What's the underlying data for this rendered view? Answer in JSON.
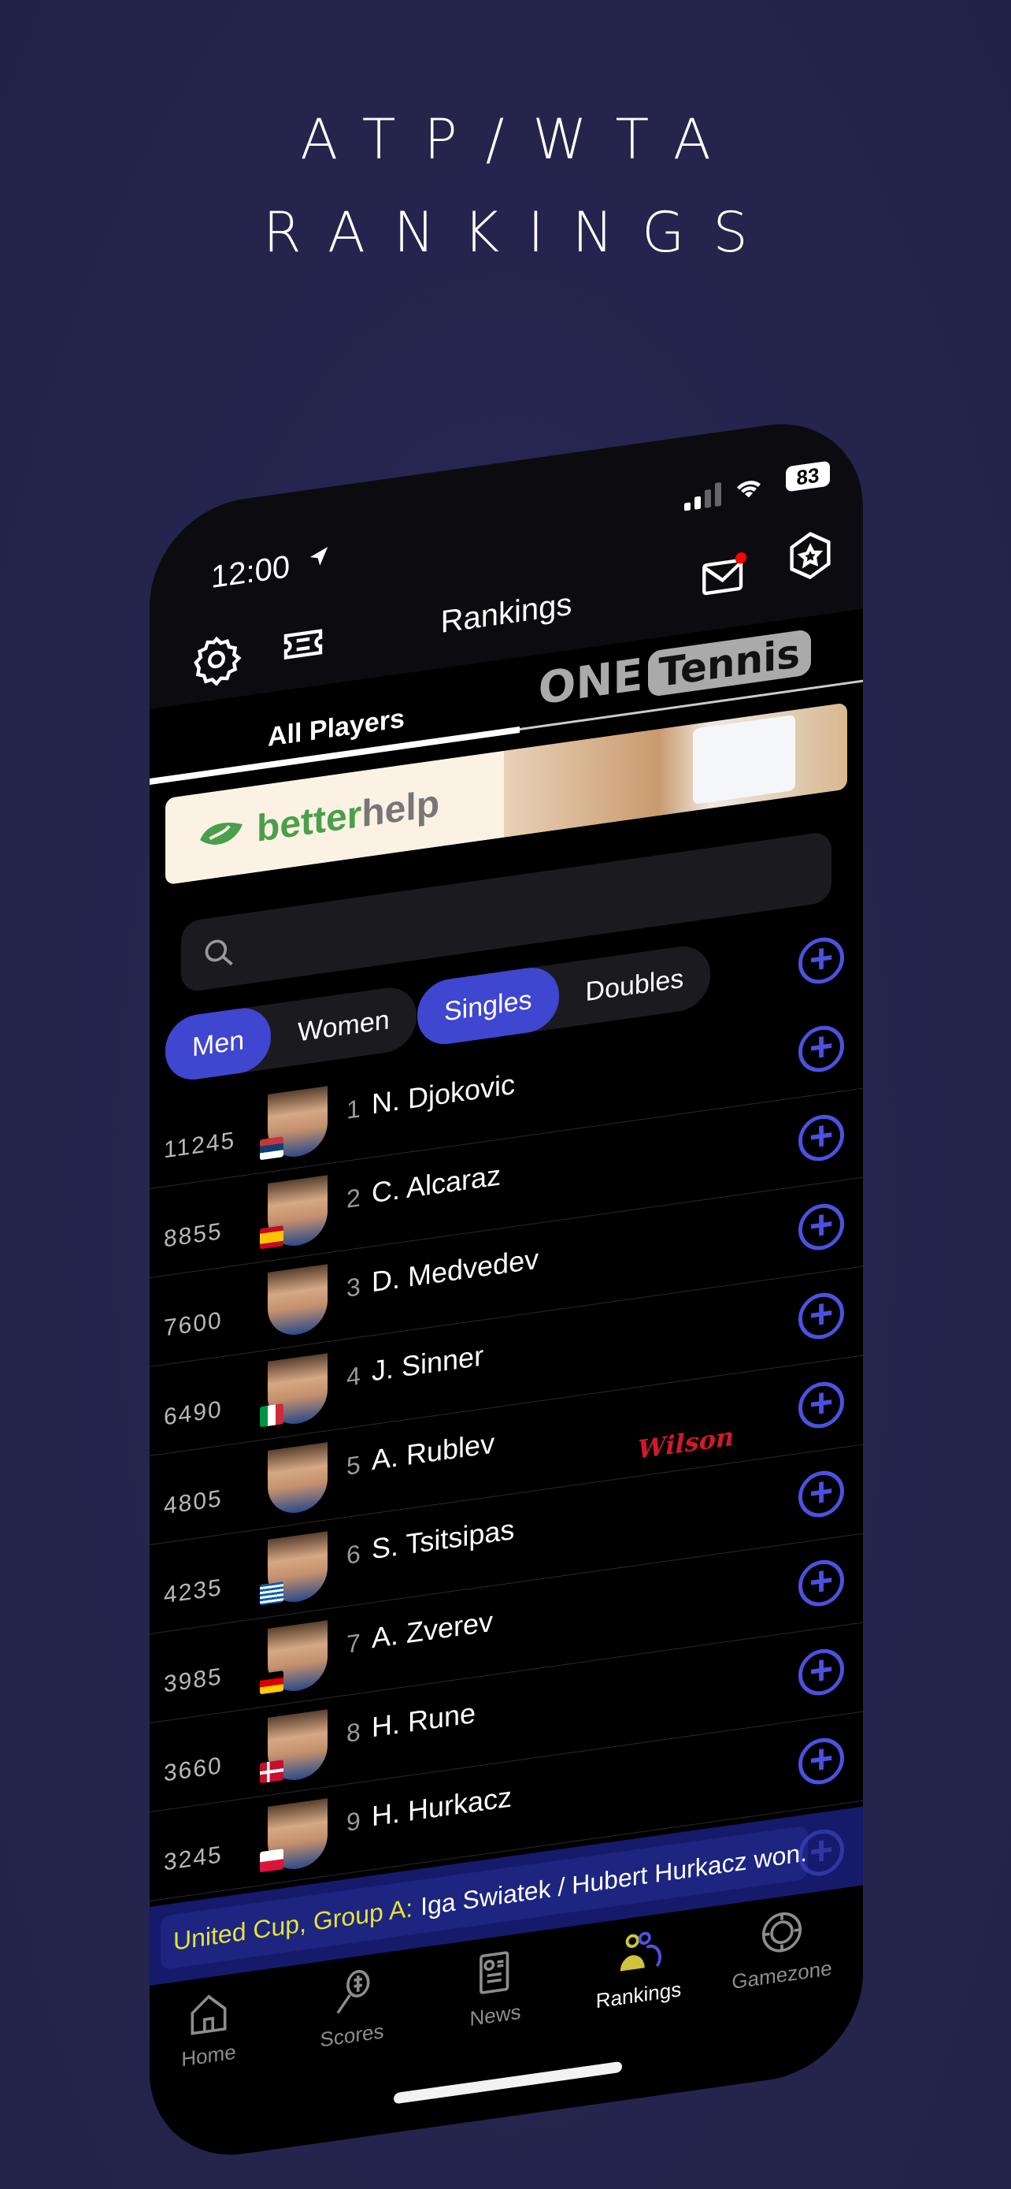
{
  "headline": {
    "line1": "ATP/WTA",
    "line2": "RANKINGS"
  },
  "status_bar": {
    "time": "12:00",
    "battery": "83"
  },
  "nav": {
    "title": "Rankings",
    "mail_has_notification": true
  },
  "tabs": {
    "active": "All Players",
    "logo_one": "ONE",
    "logo_tennis": "Tennis"
  },
  "ad": {
    "brand_part1": "better",
    "brand_part2": "help"
  },
  "search": {
    "placeholder": "",
    "value": ""
  },
  "filters": {
    "gender": [
      {
        "label": "Men",
        "selected": true
      },
      {
        "label": "Women",
        "selected": false
      }
    ],
    "type": [
      {
        "label": "Singles",
        "selected": true
      },
      {
        "label": "Doubles",
        "selected": false
      }
    ]
  },
  "players": [
    {
      "rank": "1",
      "name": "N. Djokovic",
      "points": "11245",
      "flag": "serbia"
    },
    {
      "rank": "2",
      "name": "C. Alcaraz",
      "points": "8855",
      "flag": "spain"
    },
    {
      "rank": "3",
      "name": "D. Medvedev",
      "points": "7600",
      "flag": ""
    },
    {
      "rank": "4",
      "name": "J. Sinner",
      "points": "6490",
      "flag": "italy"
    },
    {
      "rank": "5",
      "name": "A. Rublev",
      "points": "4805",
      "flag": "",
      "sponsor": "Wilson"
    },
    {
      "rank": "6",
      "name": "S. Tsitsipas",
      "points": "4235",
      "flag": "greece"
    },
    {
      "rank": "7",
      "name": "A. Zverev",
      "points": "3985",
      "flag": "germany"
    },
    {
      "rank": "8",
      "name": "H. Rune",
      "points": "3660",
      "flag": "denmark"
    },
    {
      "rank": "9",
      "name": "H. Hurkacz",
      "points": "3245",
      "flag": "poland"
    }
  ],
  "ticker": {
    "label": "United Cup, Group A:",
    "text": "Iga Swiatek / Hubert Hurkacz won..."
  },
  "tabbar": [
    {
      "label": "Home",
      "icon": "home-icon",
      "active": false
    },
    {
      "label": "Scores",
      "icon": "racket-icon",
      "active": false
    },
    {
      "label": "News",
      "icon": "newspaper-icon",
      "active": false
    },
    {
      "label": "Rankings",
      "icon": "people-icon",
      "active": true
    },
    {
      "label": "Gamezone",
      "icon": "chip-icon",
      "active": false
    }
  ],
  "colors": {
    "accent": "#3f46cf",
    "ticker_label": "#e6e23a",
    "sponsor": "#d2192a",
    "notification": "#ff0000"
  }
}
